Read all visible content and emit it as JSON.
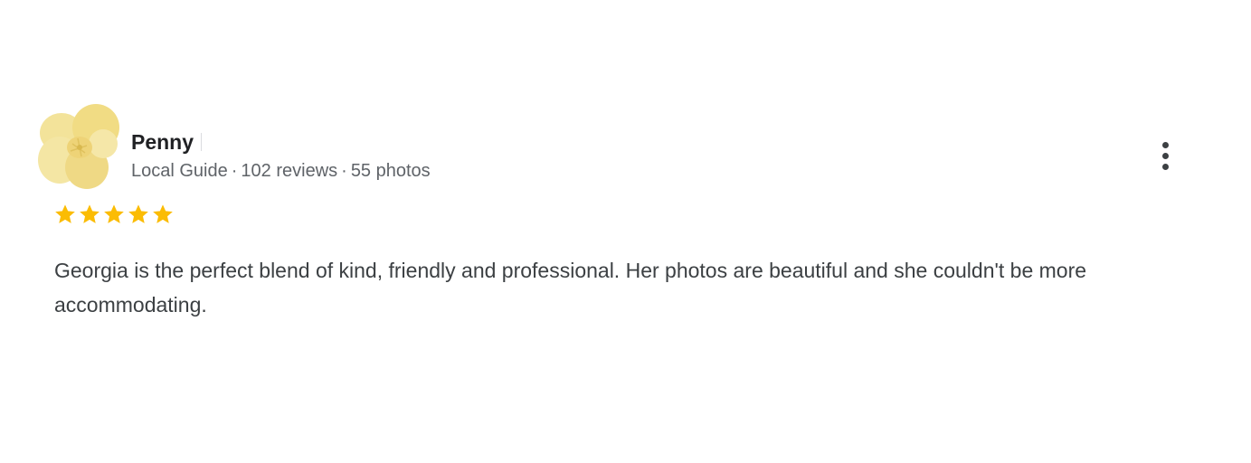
{
  "review": {
    "reviewer": {
      "name": "Penny",
      "badge": "Local Guide",
      "reviews_count": "102 reviews",
      "photos_count": "55 photos",
      "separator": "·"
    },
    "rating": {
      "stars": 5,
      "max": 5,
      "icon": "star-icon",
      "color": "#fbbc04"
    },
    "text": "Georgia is the perfect blend of kind, friendly and professional. Her photos are beautiful and she couldn't be more accommodating.",
    "more_icon": "more-vert-icon"
  },
  "colors": {
    "name": "#202124",
    "meta": "#5f6368",
    "body_text": "#3c4043",
    "star": "#fbbc04",
    "avatar_petal": "#f2de86"
  }
}
